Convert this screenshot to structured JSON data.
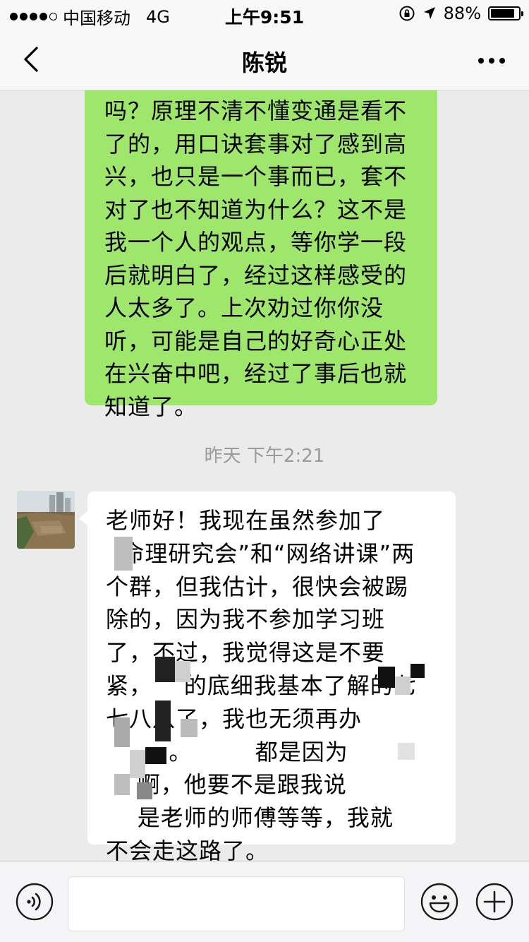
{
  "status_bar": {
    "carrier": "中国移动",
    "network": "4G",
    "time": "上午9:51",
    "battery": "88%",
    "battery_level": 0.88
  },
  "nav": {
    "title": "陈锐",
    "back_icon": "chevron-left-icon",
    "more_icon": "ellipsis-icon"
  },
  "messages": {
    "sent_1": {
      "text": "吗？原理不清不懂变通是看不\n了的，用口诀套事对了感到高\n兴，也只是一个事而已，套不\n对了也不知道为什么？这不是\n我一个人的观点，等你学一段\n后就明白了，经过这样感受的\n人太多了。上次劝过你你没\n听，可能是自己的好奇心正处\n在兴奋中吧，经过了事后也就\n知道了。",
      "bubble_color": "#9ee66c"
    },
    "timestamp": "昨天 下午2:21",
    "received_1": {
      "text": "老师好！我现在虽然参加了\n  命理研究会”和“网络讲课”两\n个群，但我估计，很快会被踢\n除的，因为我不参加学习班\n了，不过，我觉得这是不要\n紧，    的底细我基本了解的七\n七八八了，我也无须再办\n        。        都是因为\n    啊，他要不是跟我说\n    是老师的师傅等等，我就\n不会走这路了。",
      "bubble_color": "#ffffff"
    }
  },
  "input_bar": {
    "voice_icon": "voice-icon",
    "input_value": "",
    "emoji_icon": "emoji-icon",
    "plus_icon": "plus-icon"
  }
}
